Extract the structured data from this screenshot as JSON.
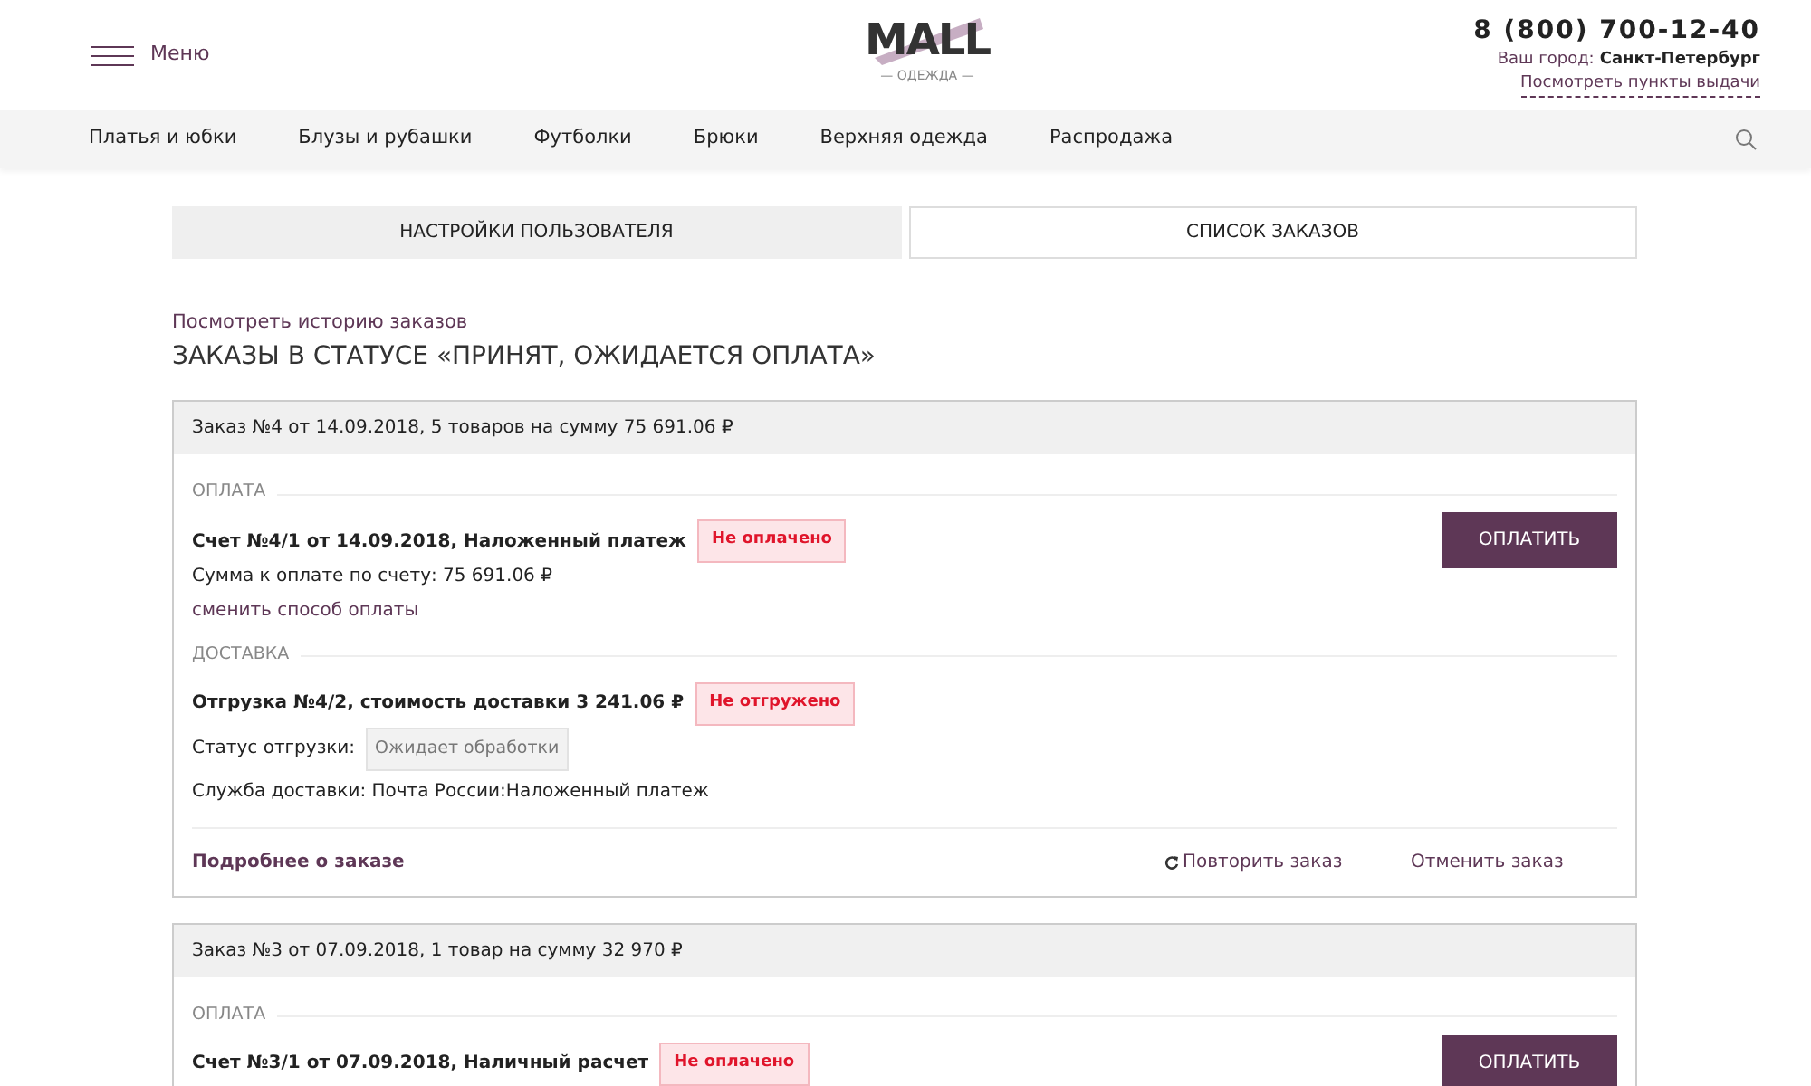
{
  "header": {
    "menu_label": "Меню",
    "logo": {
      "title": "MALL",
      "subtitle": "— ОДЕЖДА —"
    },
    "phone": "8 (800) 700-12-40",
    "city_label": "Ваш город:",
    "city": "Санкт-Петербург",
    "pickup_link": "Посмотреть пункты выдачи"
  },
  "nav": {
    "items": [
      "Платья и юбки",
      "Блузы и рубашки",
      "Футболки",
      "Брюки",
      "Верхняя одежда",
      "Распродажа"
    ]
  },
  "tabs": [
    {
      "label": "НАСТРОЙКИ ПОЛЬЗОВАТЕЛЯ",
      "selected": false
    },
    {
      "label": "СПИСОК ЗАКАЗОВ",
      "selected": true
    }
  ],
  "history_link": "Посмотреть историю заказов",
  "heading": "ЗАКАЗЫ В СТАТУСЕ «ПРИНЯТ, ОЖИДАЕТСЯ ОПЛАТА»",
  "orders": [
    {
      "title": "Заказ №4 от 14.09.2018, 5 товаров на сумму 75 691.06 ₽",
      "sections": [
        {
          "kind": "payment",
          "title": "ОПЛАТА",
          "name": "Счет №4/1 от 14.09.2018, Наложенный платеж",
          "badge": "Не оплачено",
          "amount": "Сумма к оплате по счету: 75 691.06 ₽",
          "link": "сменить способ оплаты",
          "button": "ОПЛАТИТЬ"
        },
        {
          "kind": "delivery",
          "title": "ДОСТАВКА",
          "name": "Отгрузка №4/2, стоимость доставки 3 241.06 ₽",
          "badge": "Не отгружено",
          "status_label": "Статус отгрузки:",
          "status": "Ожидает обработки",
          "service": "Служба доставки: Почта России:Наложенный платеж"
        }
      ],
      "footer": {
        "details": "Подробнее о заказе",
        "repeat": "Повторить заказ",
        "cancel": "Отменить заказ"
      }
    },
    {
      "title": "Заказ №3 от 07.09.2018, 1 товар на сумму 32 970 ₽",
      "sections": [
        {
          "kind": "payment",
          "title": "ОПЛАТА",
          "name": "Счет №3/1 от 07.09.2018, Наличный расчет",
          "badge": "Не оплачено",
          "button": "ОПЛАТИТЬ"
        }
      ]
    }
  ]
}
